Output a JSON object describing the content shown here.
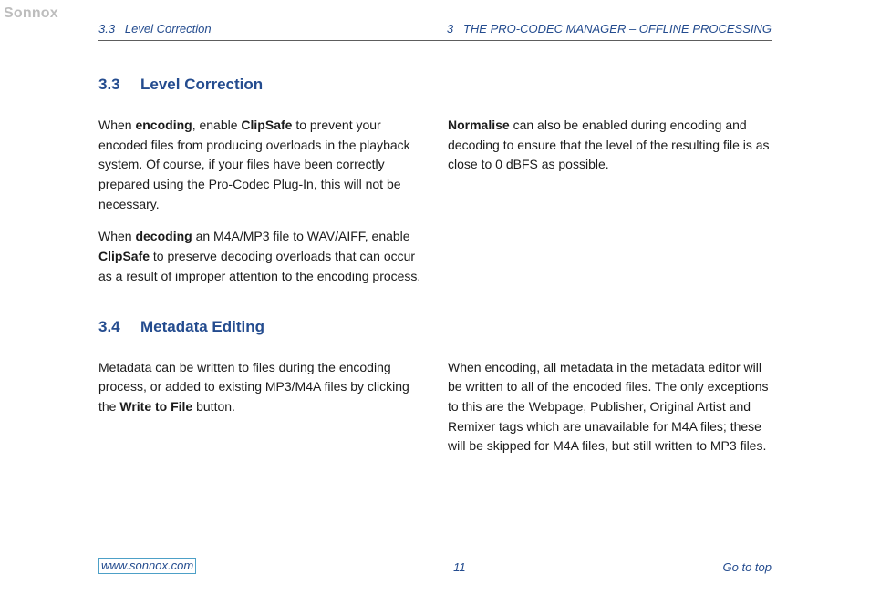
{
  "watermark": "Sonnox",
  "header": {
    "left_section_num": "3.3",
    "left_section_title": "Level Correction",
    "right_chapter_num": "3",
    "right_chapter_title": "THE PRO-CODEC MANAGER – OFFLINE PROCESSING"
  },
  "sections": {
    "s33": {
      "num": "3.3",
      "title": "Level Correction",
      "col1": {
        "p1": {
          "pre1": "When ",
          "b1": "encoding",
          "mid1": ", enable ",
          "b2": "ClipSafe",
          "post1": " to prevent your encoded files from producing overloads in the playback system. Of course, if your files have been correctly prepared using the Pro-Codec Plug-In, this will not be necessary."
        },
        "p2": {
          "pre1": "When ",
          "b1": "decoding",
          "mid1": " an M4A/MP3 file to WAV/AIFF, enable ",
          "b2": "ClipSafe",
          "post1": " to preserve decoding overloads that can occur as a result of improper attention to the encoding process."
        }
      },
      "col2": {
        "p1": {
          "b1": "Normalise",
          "post1": " can also be enabled during encoding and decoding to ensure that the level of the resulting file is as close to 0 dBFS as possible."
        }
      }
    },
    "s34": {
      "num": "3.4",
      "title": "Metadata Editing",
      "col1": {
        "p1": {
          "pre1": "Metadata can be written to files during the encoding process, or added to existing MP3/M4A files by clicking the ",
          "b1": "Write to File",
          "post1": " button."
        }
      },
      "col2": {
        "p1": "When encoding, all metadata in the metadata editor will be written to all of the encoded files. The only exceptions to this are the Webpage, Publisher, Original Artist and Remixer tags which are unavailable for M4A files; these will be skipped for M4A files, but still written to MP3 files."
      }
    }
  },
  "footer": {
    "url": "www.sonnox.com",
    "page_number": "11",
    "go_to_top": "Go to top"
  }
}
